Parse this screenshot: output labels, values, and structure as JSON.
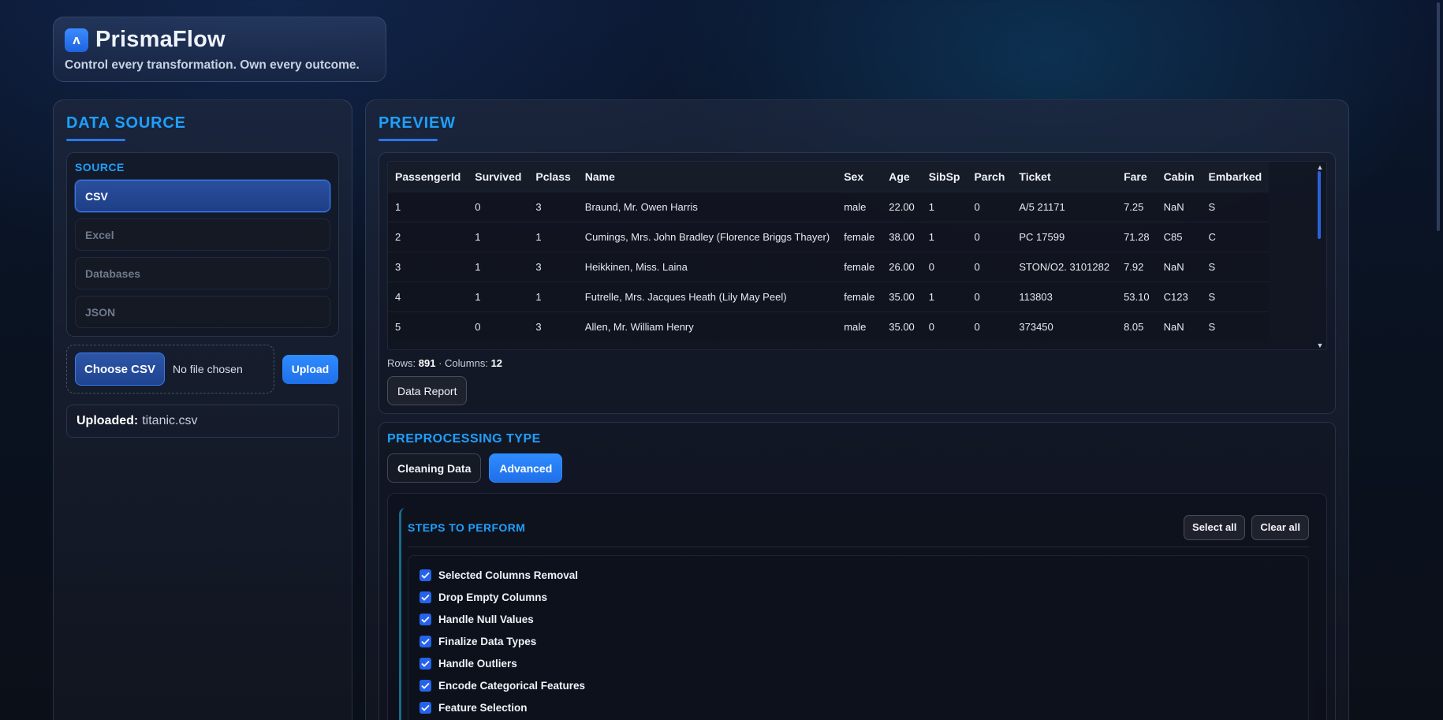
{
  "app": {
    "name": "PrismaFlow",
    "logo_glyph": "ʌ",
    "tagline": "Control every transformation. Own every outcome."
  },
  "data_source": {
    "title": "DATA SOURCE",
    "source_label": "SOURCE",
    "sources": [
      {
        "label": "CSV",
        "active": true
      },
      {
        "label": "Excel",
        "active": false
      },
      {
        "label": "Databases",
        "active": false
      },
      {
        "label": "JSON",
        "active": false
      }
    ],
    "choose_label": "Choose CSV",
    "file_status": "No file chosen",
    "upload_label": "Upload",
    "uploaded_label": "Uploaded:",
    "uploaded_file": "titanic.csv"
  },
  "preview": {
    "title": "PREVIEW",
    "columns": [
      "PassengerId",
      "Survived",
      "Pclass",
      "Name",
      "Sex",
      "Age",
      "SibSp",
      "Parch",
      "Ticket",
      "Fare",
      "Cabin",
      "Embarked"
    ],
    "rows": [
      [
        "1",
        "0",
        "3",
        "Braund, Mr. Owen Harris",
        "male",
        "22.00",
        "1",
        "0",
        "A/5 21171",
        "7.25",
        "NaN",
        "S"
      ],
      [
        "2",
        "1",
        "1",
        "Cumings, Mrs. John Bradley (Florence Briggs Thayer)",
        "female",
        "38.00",
        "1",
        "0",
        "PC 17599",
        "71.28",
        "C85",
        "C"
      ],
      [
        "3",
        "1",
        "3",
        "Heikkinen, Miss. Laina",
        "female",
        "26.00",
        "0",
        "0",
        "STON/O2. 3101282",
        "7.92",
        "NaN",
        "S"
      ],
      [
        "4",
        "1",
        "1",
        "Futrelle, Mrs. Jacques Heath (Lily May Peel)",
        "female",
        "35.00",
        "1",
        "0",
        "113803",
        "53.10",
        "C123",
        "S"
      ],
      [
        "5",
        "0",
        "3",
        "Allen, Mr. William Henry",
        "male",
        "35.00",
        "0",
        "0",
        "373450",
        "8.05",
        "NaN",
        "S"
      ]
    ],
    "rows_label": "Rows:",
    "rows_count": "891",
    "columns_label": "· Columns:",
    "columns_count": "12",
    "report_label": "Data Report"
  },
  "preprocessing": {
    "title": "PREPROCESSING TYPE",
    "tabs": [
      {
        "label": "Cleaning Data",
        "active": false
      },
      {
        "label": "Advanced",
        "active": true
      }
    ],
    "steps_title": "STEPS TO PERFORM",
    "select_all_label": "Select all",
    "clear_all_label": "Clear all",
    "steps": [
      {
        "label": "Selected Columns Removal",
        "checked": true
      },
      {
        "label": "Drop Empty Columns",
        "checked": true
      },
      {
        "label": "Handle Null Values",
        "checked": true
      },
      {
        "label": "Finalize Data Types",
        "checked": true
      },
      {
        "label": "Handle Outliers",
        "checked": true
      },
      {
        "label": "Encode Categorical Features",
        "checked": true
      },
      {
        "label": "Feature Selection",
        "checked": true
      }
    ]
  },
  "colors": {
    "accent": "#1ea0ff",
    "primary_button": "#2f8cff",
    "checkbox": "#2563eb"
  }
}
